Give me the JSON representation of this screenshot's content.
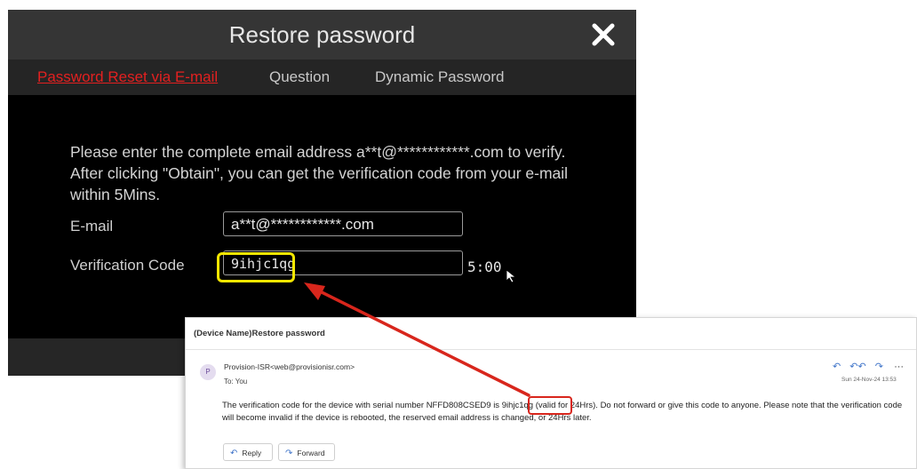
{
  "dialog": {
    "title": "Restore password",
    "tabs": [
      {
        "label": "Password Reset via E-mail",
        "active": true
      },
      {
        "label": "Question",
        "active": false
      },
      {
        "label": "Dynamic Password",
        "active": false
      }
    ],
    "instructions": "Please enter the complete email address a**t@************.com to verify. After clicking \"Obtain\", you can get the verification code from your e-mail within 5Mins.",
    "email_label": "E-mail",
    "email_value": "a**t@************.com",
    "code_label": "Verification Code",
    "code_value": "9ihjc1qg",
    "countdown": "5:00"
  },
  "email": {
    "subject": "(Device Name)Restore password",
    "avatar_initial": "P",
    "sender": "Provision-ISR<web@provisionisr.com>",
    "to": "To: You",
    "date": "Sun 24-Nov-24 13:53",
    "body_before": "The verification code for the device with serial number NFFD808CSED9 is ",
    "body_code": "9ihjc1qg",
    "body_after": " (valid for 24Hrs). Do not forward or give this code to anyone. Please note that the verification code will become invalid if the device is rebooted, the reserved email address is changed, or 24Hrs later.",
    "reply_label": "Reply",
    "forward_label": "Forward",
    "more_label": "···"
  },
  "icons": {
    "close": "close-x-icon",
    "cursor": "mouse-pointer-icon",
    "reply": "reply-arrow-icon",
    "reply_all": "reply-all-icon",
    "forward": "forward-arrow-icon"
  },
  "colors": {
    "active_tab": "#e32020",
    "highlight_yellow": "#f3e600",
    "highlight_red": "#d8261c",
    "arrow": "#d8261c",
    "link_blue": "#3f74c9"
  }
}
